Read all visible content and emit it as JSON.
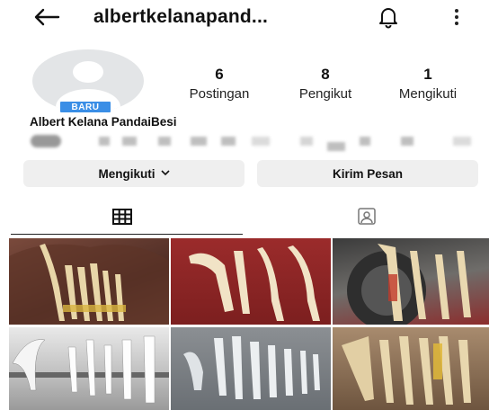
{
  "header": {
    "username": "albertkelanapand...",
    "back_icon": "arrow-left-icon",
    "bell_icon": "bell-icon",
    "menu_icon": "kebab-menu-icon"
  },
  "profile": {
    "new_badge": "BARU",
    "display_name": "Albert Kelana PandaiBesi",
    "stats": [
      {
        "value": "6",
        "label": "Postingan"
      },
      {
        "value": "8",
        "label": "Pengikut"
      },
      {
        "value": "1",
        "label": "Mengikuti"
      }
    ]
  },
  "actions": {
    "following_label": "Mengikuti",
    "message_label": "Kirim Pesan"
  },
  "tabs": {
    "grid_icon": "grid-icon",
    "tagged_icon": "tagged-person-icon"
  },
  "colors": {
    "badge": "#3a8ee6",
    "button_bg": "#efefef"
  }
}
